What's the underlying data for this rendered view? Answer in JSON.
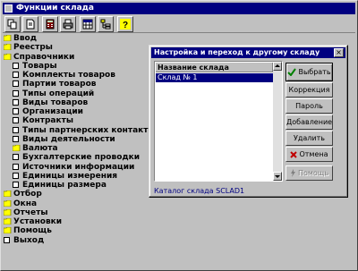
{
  "window": {
    "title": "Функции склада"
  },
  "toolbar": {
    "buttons": [
      {
        "icon": "copy-icon"
      },
      {
        "icon": "document-icon"
      },
      {
        "icon": "calculator-icon"
      },
      {
        "icon": "printer-icon"
      },
      {
        "icon": "calendar-icon"
      },
      {
        "icon": "tree-view-icon"
      },
      {
        "icon": "help-icon",
        "label": "?"
      }
    ]
  },
  "tree": {
    "items": [
      {
        "label": "Ввод",
        "type": "folder",
        "level": 0
      },
      {
        "label": "Реестры",
        "type": "folder",
        "level": 0
      },
      {
        "label": "Справочники",
        "type": "folder-open",
        "level": 0
      },
      {
        "label": "Товары",
        "type": "item",
        "level": 1
      },
      {
        "label": "Комплекты товаров",
        "type": "item",
        "level": 1
      },
      {
        "label": "Партии товаров",
        "type": "item",
        "level": 1
      },
      {
        "label": "Типы операций",
        "type": "item",
        "level": 1
      },
      {
        "label": "Виды товаров",
        "type": "item",
        "level": 1
      },
      {
        "label": "Организации",
        "type": "item",
        "level": 1
      },
      {
        "label": "Контракты",
        "type": "item",
        "level": 1
      },
      {
        "label": "Типы партнерских контактов",
        "type": "item",
        "level": 1
      },
      {
        "label": "Виды деятельности",
        "type": "item",
        "level": 1
      },
      {
        "label": "Валюта",
        "type": "folder",
        "level": 1
      },
      {
        "label": "Бухгалтерские проводки",
        "type": "item",
        "level": 1
      },
      {
        "label": "Источники информации",
        "type": "item",
        "level": 1
      },
      {
        "label": "Единицы измерения",
        "type": "item",
        "level": 1
      },
      {
        "label": "Единицы размера",
        "type": "item",
        "level": 1
      },
      {
        "label": "Отбор",
        "type": "folder",
        "level": 0
      },
      {
        "label": "Окна",
        "type": "folder",
        "level": 0
      },
      {
        "label": "Отчеты",
        "type": "folder",
        "level": 0
      },
      {
        "label": "Установки",
        "type": "folder",
        "level": 0
      },
      {
        "label": "Помощь",
        "type": "folder",
        "level": 0
      },
      {
        "label": "Выход",
        "type": "item",
        "level": 0
      }
    ]
  },
  "dialog": {
    "title": "Настройка и переход к другому складу",
    "close_label": "×",
    "list_header": "Название склада",
    "rows": [
      "Склад № 1"
    ],
    "status": "Каталог склада SCLAD1",
    "buttons": {
      "select": "Выбрать",
      "correction": "Коррекция",
      "password": "Пароль",
      "add": "Добавление",
      "delete": "Удалить",
      "cancel": "Отмена",
      "help": "Помощь"
    }
  },
  "colors": {
    "titlebar": "#000080",
    "selection": "#000080",
    "folder": "#ffff00",
    "face": "#c0c0c0"
  }
}
